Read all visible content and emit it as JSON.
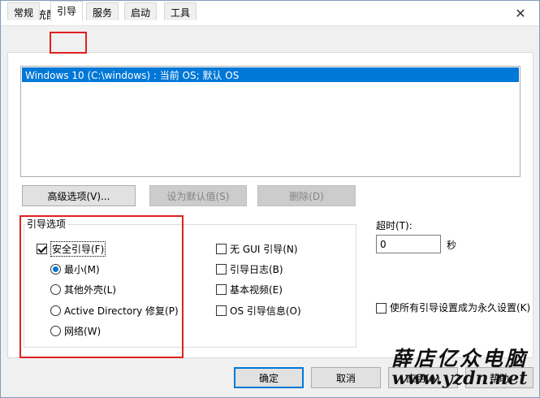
{
  "window": {
    "title": "系统配置",
    "close_glyph": "✕"
  },
  "tabs": [
    {
      "label": "常规",
      "active": false
    },
    {
      "label": "引导",
      "active": true
    },
    {
      "label": "服务",
      "active": false
    },
    {
      "label": "启动",
      "active": false
    },
    {
      "label": "工具",
      "active": false
    }
  ],
  "os_list": {
    "items": [
      "Windows 10 (C:\\windows) : 当前 OS; 默认 OS"
    ],
    "selected_index": 0
  },
  "buttons": {
    "advanced": "高级选项(V)...",
    "set_default": "设为默认值(S)",
    "delete": "删除(D)",
    "ok": "确定",
    "cancel": "取消",
    "apply": "应用(A)",
    "help": "帮助"
  },
  "boot_options": {
    "group_label": "引导选项",
    "safe_boot": {
      "label": "安全引导(F)",
      "checked": true
    },
    "radios": [
      {
        "label": "最小(M)",
        "checked": true
      },
      {
        "label": "其他外壳(L)",
        "checked": false
      },
      {
        "label": "Active Directory 修复(P)",
        "checked": false
      },
      {
        "label": "网络(W)",
        "checked": false
      }
    ],
    "right_checks": [
      {
        "label": "无 GUI 引导(N)",
        "checked": false
      },
      {
        "label": "引导日志(B)",
        "checked": false
      },
      {
        "label": "基本视频(E)",
        "checked": false
      },
      {
        "label": "OS 引导信息(O)",
        "checked": false
      }
    ]
  },
  "timeout": {
    "label": "超时(T):",
    "value": "0",
    "unit": "秒"
  },
  "permanent": {
    "label": "使所有引导设置成为永久设置(K)",
    "checked": false
  },
  "watermark": {
    "line1": "薛店亿众电脑",
    "line2": "www.yzdn.net"
  },
  "colors": {
    "selection": "#0078d7",
    "highlight_box": "#e02020"
  }
}
